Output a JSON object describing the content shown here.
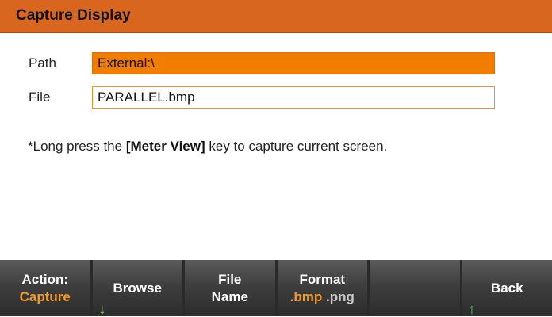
{
  "window": {
    "title": "Capture Display"
  },
  "path": {
    "label": "Path",
    "value": "External:\\"
  },
  "file": {
    "label": "File",
    "value": "PARALLEL.bmp"
  },
  "note": {
    "prefix": "*Long press the ",
    "key": "[Meter View]",
    "suffix": " key to capture current screen."
  },
  "softkeys": {
    "action": {
      "line1": "Action:",
      "line2": "Capture"
    },
    "browse": {
      "label": "Browse",
      "arrow": "down-arrow-icon"
    },
    "file_name": {
      "line1": "File",
      "line2": "Name"
    },
    "format": {
      "line1": "Format",
      "option_selected": ".bmp",
      "option_other": ".png"
    },
    "blank": {
      "label": ""
    },
    "back": {
      "label": "Back",
      "arrow": "up-arrow-icon"
    }
  },
  "colors": {
    "title_bar": "#d9661f",
    "path_field": "#f07d00",
    "accent_text": "#f59a22"
  }
}
